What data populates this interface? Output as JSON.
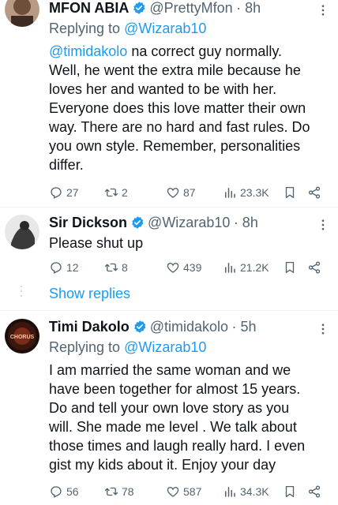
{
  "tweets": [
    {
      "name": "MFON  ABIA",
      "handle": "@PrettyMfon",
      "time": "· 8h",
      "replying_prefix": "Replying to ",
      "replying_to": "@Wizarab10",
      "mention": "@timidakolo",
      "text": " na correct guy normally.\nWell, he went the extra mile because he\nloves her and wanted to be with her.\nEveryone does this love matter their own\nway. There are no hard and fast rules. Do\nyou own style. Remember, personalities\ndiffer.",
      "replies": "27",
      "retweets": "2",
      "likes": "87",
      "views": "23.3K"
    },
    {
      "name": "Sir Dickson",
      "handle": "@Wizarab10",
      "time": "· 8h",
      "text": "Please shut up",
      "replies": "12",
      "retweets": "8",
      "likes": "439",
      "views": "21.2K"
    },
    {
      "name": "Timi Dakolo",
      "handle": "@timidakolo",
      "time": "· 5h",
      "replying_prefix": "Replying to ",
      "replying_to": "@Wizarab10",
      "avatar_text": "CHORUS",
      "text": "I am married the same woman and we\nhave been together for almost 15 years.\nDo and tell your own love story as you\nwill.  She made me level . We talk about\nthose times and laugh really hard.  I even\ngist my kids about it.  Enjoy your day",
      "replies": "56",
      "retweets": "78",
      "likes": "587",
      "views": "34.3K"
    }
  ],
  "show_replies": "Show replies",
  "colors": {
    "accent": "#1d9bf0",
    "muted": "#536471",
    "text": "#0f1419"
  },
  "icons": [
    "reply-icon",
    "retweet-icon",
    "like-icon",
    "views-icon",
    "bookmark-icon",
    "share-icon",
    "more-icon",
    "verified-icon"
  ]
}
